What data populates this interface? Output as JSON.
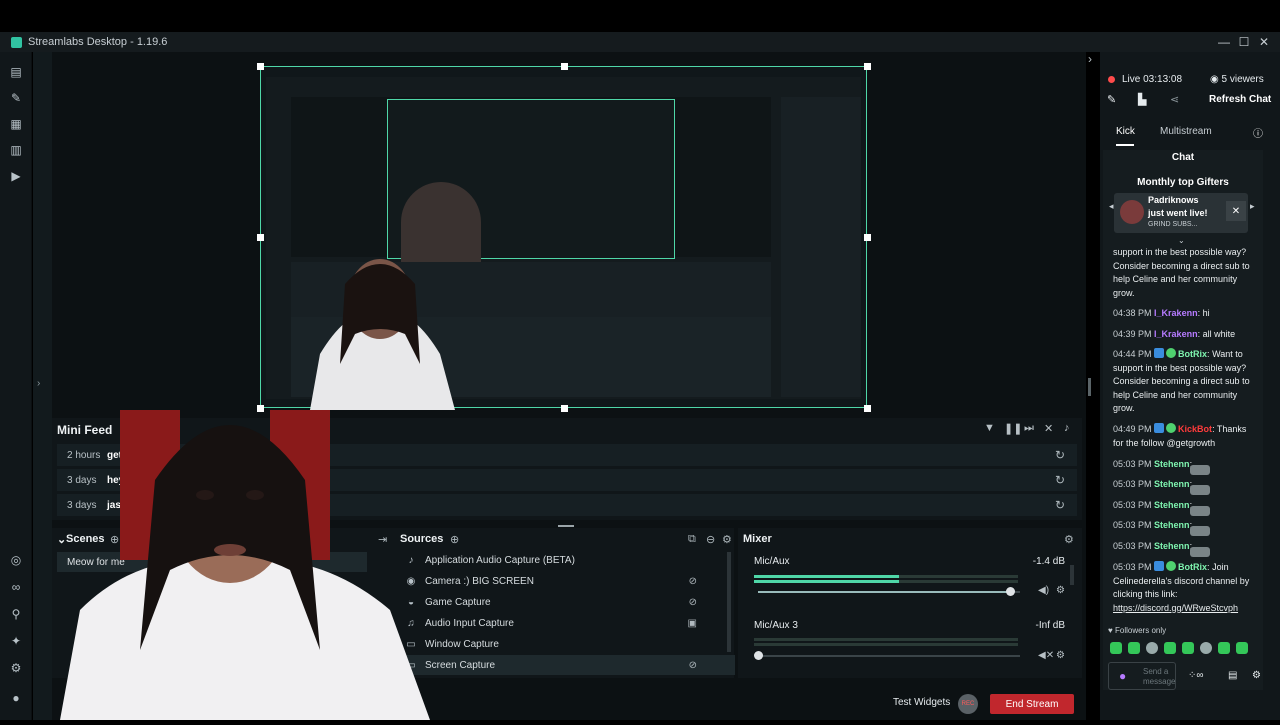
{
  "app": {
    "title": "Streamlabs Desktop - 1.19.6"
  },
  "window_controls": {
    "minimize": "—",
    "maximize": "☐",
    "close": "✕"
  },
  "stream_status": {
    "live_label": "Live 03:13:08",
    "viewers": "5 viewers",
    "refresh_chat": "Refresh Chat"
  },
  "chat_tabs": {
    "kick": "Kick",
    "multistream": "Multistream"
  },
  "chat": {
    "header": "Chat",
    "top_gifters": "Monthly top Gifters",
    "notification": {
      "name": "Padriknows",
      "text": "just went live!",
      "sub": "GRIND SUBS..."
    },
    "intro_text": "support in the best possible way? Consider becoming a direct sub to help Celine and her community grow.",
    "messages": [
      {
        "time": "04:38 PM",
        "user": "I_Krakenn",
        "text": "hi"
      },
      {
        "time": "04:39 PM",
        "user": "I_Krakenn",
        "text": "all white"
      },
      {
        "time": "04:44 PM",
        "user": "BotRix",
        "text": "Want to support in the best possible way? Consider becoming a direct sub to help Celine and her community grow."
      },
      {
        "time": "04:49 PM",
        "user": "KickBot",
        "text": "Thanks for the follow @getgrowth"
      },
      {
        "time": "05:03 PM",
        "user": "Stehenn",
        "text": ""
      },
      {
        "time": "05:03 PM",
        "user": "Stehenn",
        "text": ""
      },
      {
        "time": "05:03 PM",
        "user": "Stehenn",
        "text": ""
      },
      {
        "time": "05:03 PM",
        "user": "Stehenn",
        "text": ""
      },
      {
        "time": "05:03 PM",
        "user": "Stehenn",
        "text": ""
      },
      {
        "time": "05:03 PM",
        "user": "BotRix",
        "text": "Join Celinederella's discord channel by clicking this link:"
      }
    ],
    "link": "https://discord.gg/WRweStcvph",
    "followers_only": "Followers only",
    "send_placeholder": "Send a message"
  },
  "mini_feed": {
    "title": "Mini Feed",
    "rows": [
      {
        "time": "2 hours",
        "name": "getgro"
      },
      {
        "time": "3 days",
        "name": "heyvs"
      },
      {
        "time": "3 days",
        "name": "jasmi"
      }
    ]
  },
  "scenes": {
    "title": "Scenes",
    "items": [
      "Meow for me"
    ]
  },
  "sources": {
    "title": "Sources",
    "items": [
      "Application Audio Capture (BETA)",
      "Camera :) BIG SCREEN",
      "Game Capture",
      "Audio Input Capture",
      "Window Capture",
      "Screen Capture"
    ]
  },
  "mixer": {
    "title": "Mixer",
    "channels": [
      {
        "name": "Mic/Aux",
        "db": "-1.4 dB",
        "level": 0.55,
        "volume": 0.96
      },
      {
        "name": "Mic/Aux 3",
        "db": "-Inf dB",
        "level": 0.0,
        "volume": 0.0
      }
    ]
  },
  "footer": {
    "test_widgets": "Test Widgets",
    "rec": "REC",
    "end_stream": "End Stream"
  },
  "colors": {
    "accent": "#4fd7a8",
    "end_stream": "#c1272d",
    "live_dot": "#ff4b4b"
  }
}
